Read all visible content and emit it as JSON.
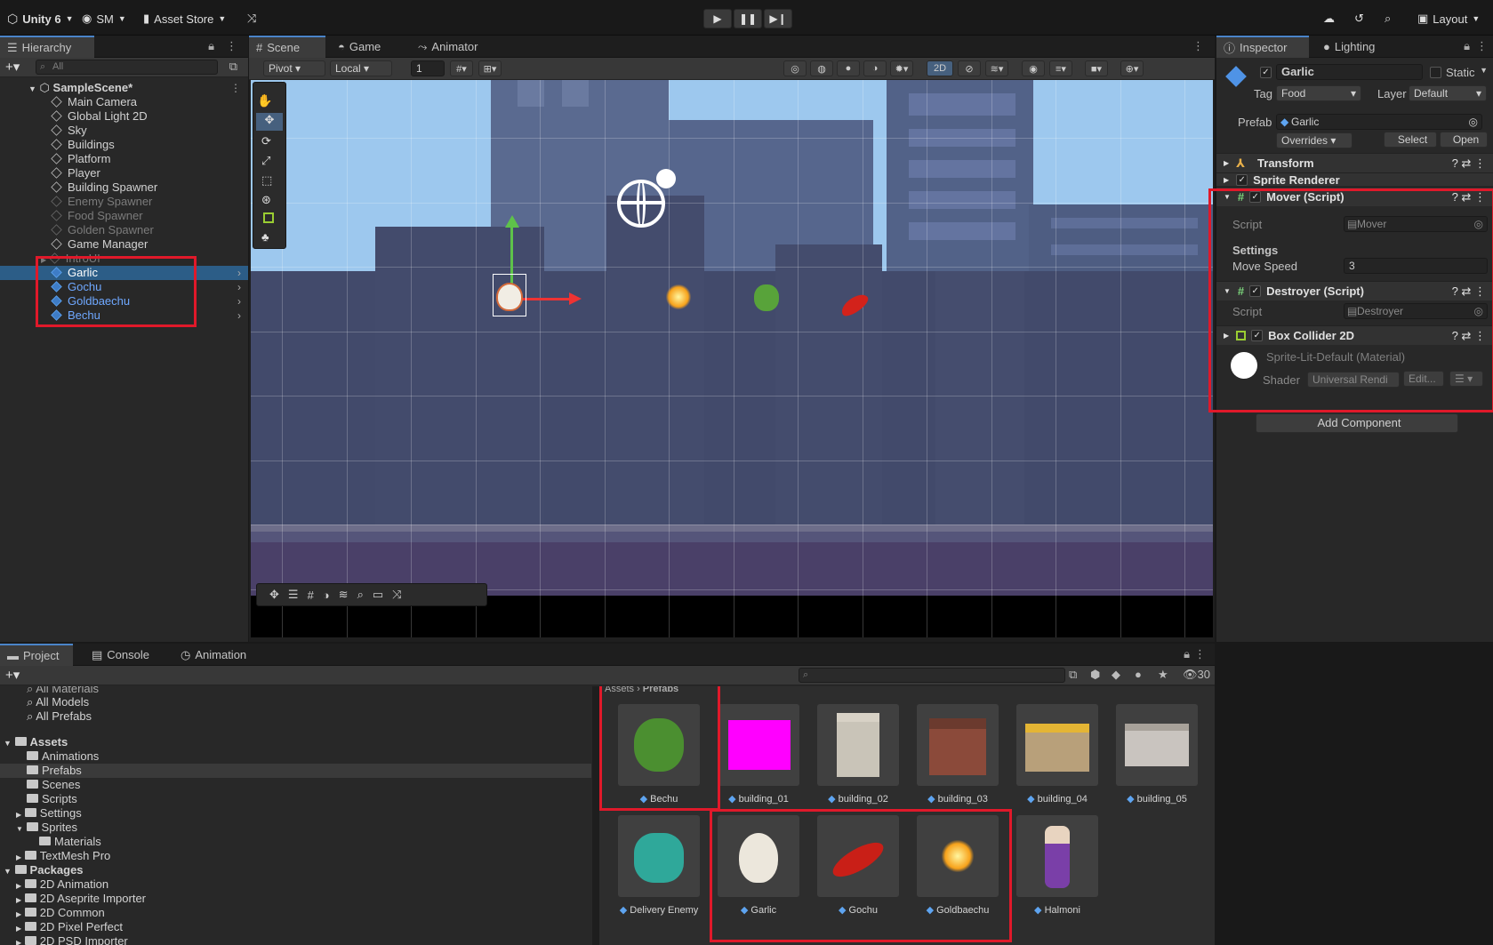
{
  "topbar": {
    "unity": "Unity 6",
    "account": "SM",
    "asset_store": "Asset Store",
    "layout": "Layout"
  },
  "hierarchy": {
    "tab": "Hierarchy",
    "search_placeholder": "All",
    "scene": "SampleScene*",
    "items": [
      "Main Camera",
      "Global Light 2D",
      "Sky",
      "Buildings",
      "Platform",
      "Player",
      "Building Spawner",
      "Enemy Spawner",
      "Food Spawner",
      "Golden Spawner",
      "Game Manager",
      "IntroUI",
      "Garlic",
      "Gochu",
      "Goldbaechu",
      "Bechu"
    ]
  },
  "scene_view": {
    "tabs": [
      "Scene",
      "Game",
      "Animator"
    ],
    "pivot": "Pivot",
    "local": "Local",
    "grid_value": "1",
    "mode_2d": "2D"
  },
  "inspector": {
    "tabs": [
      "Inspector",
      "Lighting"
    ],
    "object_name": "Garlic",
    "static_label": "Static",
    "tag_label": "Tag",
    "tag": "Food",
    "layer_label": "Layer",
    "layer": "Default",
    "prefab_label": "Prefab",
    "prefab": "Garlic",
    "overrides": "Overrides",
    "select": "Select",
    "open": "Open",
    "components": {
      "transform": "Transform",
      "sprite_renderer": "Sprite Renderer",
      "mover": "Mover (Script)",
      "script_label": "Script",
      "mover_script": "Mover",
      "settings": "Settings",
      "move_speed_label": "Move Speed",
      "move_speed": "3",
      "destroyer": "Destroyer (Script)",
      "destroyer_script": "Destroyer",
      "box_collider": "Box Collider 2D",
      "material": "Sprite-Lit-Default (Material)",
      "shader_label": "Shader",
      "shader": "Universal Rendi",
      "edit": "Edit..."
    },
    "add_component": "Add Component"
  },
  "project": {
    "tabs": [
      "Project",
      "Console",
      "Animation"
    ],
    "count": "30",
    "tree": [
      "All Materials",
      "All Models",
      "All Prefabs",
      "Assets",
      "Animations",
      "Prefabs",
      "Scenes",
      "Scripts",
      "Settings",
      "Sprites",
      "Materials",
      "TextMesh Pro",
      "Packages",
      "2D Animation",
      "2D Aseprite Importer",
      "2D Common",
      "2D Pixel Perfect",
      "2D PSD Importer"
    ],
    "breadcrumb": [
      "Assets",
      "Prefabs"
    ],
    "assets": [
      "Bechu",
      "building_01",
      "building_02",
      "building_03",
      "building_04",
      "building_05",
      "Delivery Enemy",
      "Garlic",
      "Gochu",
      "Goldbaechu",
      "Halmoni"
    ]
  },
  "colors": {
    "accent": "#2c5d87",
    "highlight": "#e0192a",
    "magenta": "#ff00ff"
  }
}
